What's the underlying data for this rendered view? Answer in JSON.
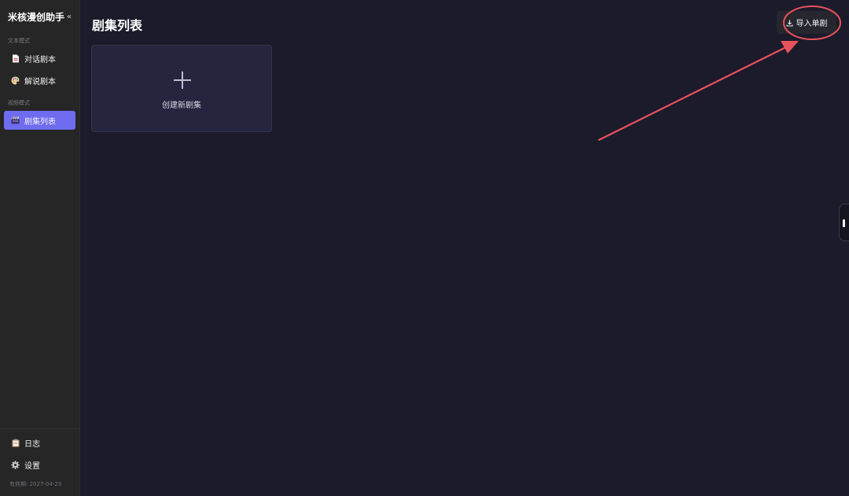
{
  "sidebar": {
    "brand": {
      "title": "米核漫创助手",
      "collapse": "«"
    },
    "sections": [
      {
        "label": "文本模式"
      },
      {
        "label": "视频模式"
      }
    ],
    "items": [
      {
        "label": "对话剧本",
        "icon": "document-icon"
      },
      {
        "label": "解说剧本",
        "icon": "palette-icon"
      },
      {
        "label": "剧集列表",
        "icon": "film-icon",
        "active": true
      }
    ],
    "bottom": [
      {
        "label": "日志",
        "icon": "clipboard-icon"
      },
      {
        "label": "设置",
        "icon": "gear-icon"
      }
    ],
    "expiry": "有效期: 2027-04-23"
  },
  "main": {
    "title": "剧集列表",
    "import_button": {
      "label": "导入单剧",
      "icon": "download-icon"
    },
    "create_card": {
      "label": "创建新剧集",
      "icon": "plus-icon"
    }
  },
  "colors": {
    "background": "#1b1b2b",
    "sidebar": "#262626",
    "accent": "#6f6cf0",
    "annotation": "#e8525a"
  }
}
